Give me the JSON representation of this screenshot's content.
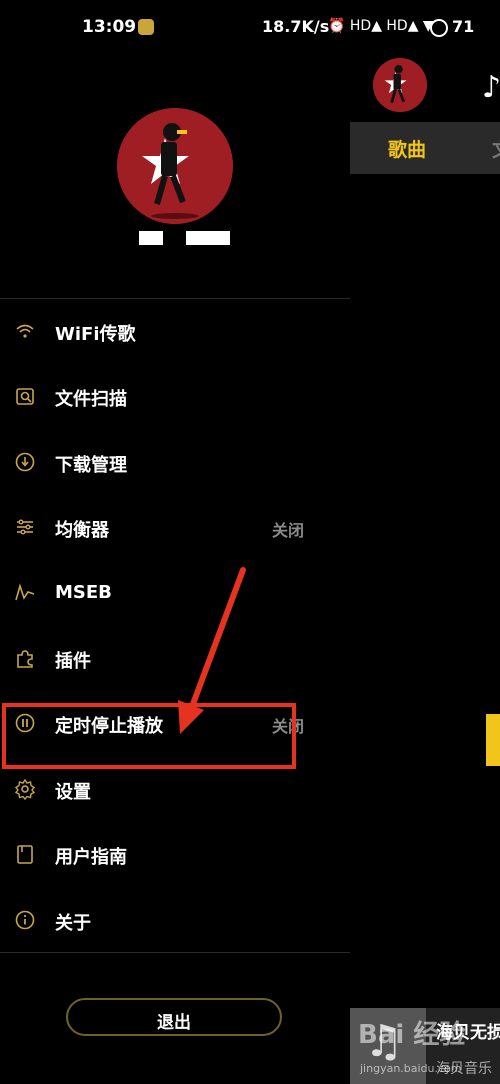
{
  "status_bar": {
    "time": "13:09",
    "net_speed": "18.7K/s",
    "icons": "⏰ HD▲ HD▲ ▼",
    "battery": "71"
  },
  "drawer": {
    "menu": [
      {
        "icon": "wifi-icon",
        "label": "WiFi传歌",
        "value": ""
      },
      {
        "icon": "file-scan-icon",
        "label": "文件扫描",
        "value": ""
      },
      {
        "icon": "download-icon",
        "label": "下载管理",
        "value": ""
      },
      {
        "icon": "equalizer-icon",
        "label": "均衡器",
        "value": "关闭"
      },
      {
        "icon": "mseb-icon",
        "label": "MSEB",
        "value": ""
      },
      {
        "icon": "plugin-icon",
        "label": "插件",
        "value": ""
      },
      {
        "icon": "timer-icon",
        "label": "定时停止播放",
        "value": "关闭"
      },
      {
        "icon": "gear-icon",
        "label": "设置",
        "value": ""
      },
      {
        "icon": "guide-icon",
        "label": "用户指南",
        "value": ""
      },
      {
        "icon": "info-icon",
        "label": "关于",
        "value": ""
      }
    ],
    "logout_label": "退出"
  },
  "main_peek": {
    "tab_label": "歌曲",
    "tab_more": "文",
    "player_title": "海贝无损",
    "player_sub": "海贝音乐"
  },
  "watermark": {
    "brand": "Bai 经验",
    "url": "jingyan.baidu.com"
  },
  "colors": {
    "accent": "#f2c51a",
    "highlight": "#e53221",
    "avatar_bg": "#9e1e23",
    "menu_icon": "#c8a64a"
  }
}
